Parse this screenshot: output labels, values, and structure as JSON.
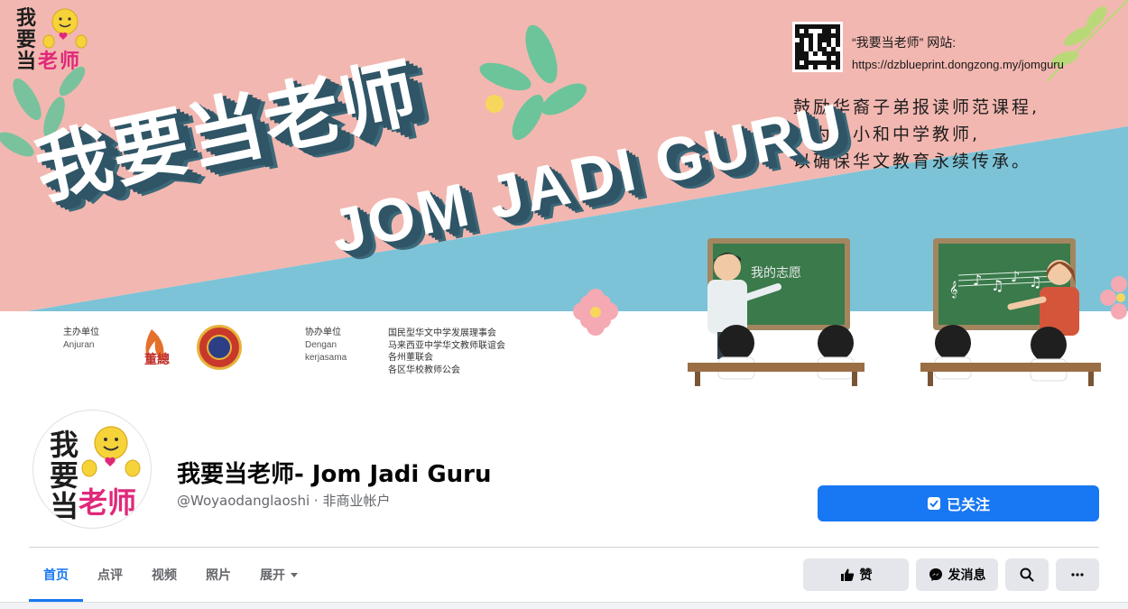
{
  "cover": {
    "logo_chars": [
      "我",
      "要",
      "当",
      "老",
      "师"
    ],
    "title_zh": "我要当老师",
    "title_en": "JOM JADI GURU",
    "site_label": "“我要当老师” 网站:",
    "site_url": "https://dzblueprint.dongzong.my/jomguru",
    "slogan_lines": [
      "鼓励华裔子弟报读师范课程,",
      "成为华小和中学教师,",
      "以确保华文教育永续传承。"
    ],
    "organizer": {
      "label": "主办单位",
      "label_ms": "Anjuran",
      "logo_text": "董總"
    },
    "collaborator": {
      "label": "协办单位",
      "label_ms_1": "Dengan",
      "label_ms_2": "kerjasama"
    },
    "collaborator_list": [
      "国民型华文中学发展理事会",
      "马来西亚中学华文教师联谊会",
      "各州董联会",
      "各区华校教师公会"
    ],
    "board_text_left": "我的志愿",
    "colors": {
      "pink": "#f2b7b0",
      "blue": "#7cc3d7",
      "teal_dark": "#2f5566",
      "green_leaf": "#6cc49b",
      "board": "#3a7a4b"
    }
  },
  "profile": {
    "avatar_chars": [
      "我",
      "要",
      "当",
      "老",
      "师"
    ],
    "page_name": "我要当老师- Jom Jadi Guru",
    "handle": "@Woyaodanglaoshi · 非商业帐户",
    "follow_label": "已关注"
  },
  "tabs": [
    {
      "label": "首页",
      "active": true
    },
    {
      "label": "点评",
      "active": false
    },
    {
      "label": "视频",
      "active": false
    },
    {
      "label": "照片",
      "active": false
    },
    {
      "label": "展开",
      "active": false
    }
  ],
  "actions": {
    "like_label": "赞",
    "message_label": "发消息",
    "search_icon": "search-icon",
    "more_icon": "more-icon"
  },
  "accent": "#1877f2"
}
